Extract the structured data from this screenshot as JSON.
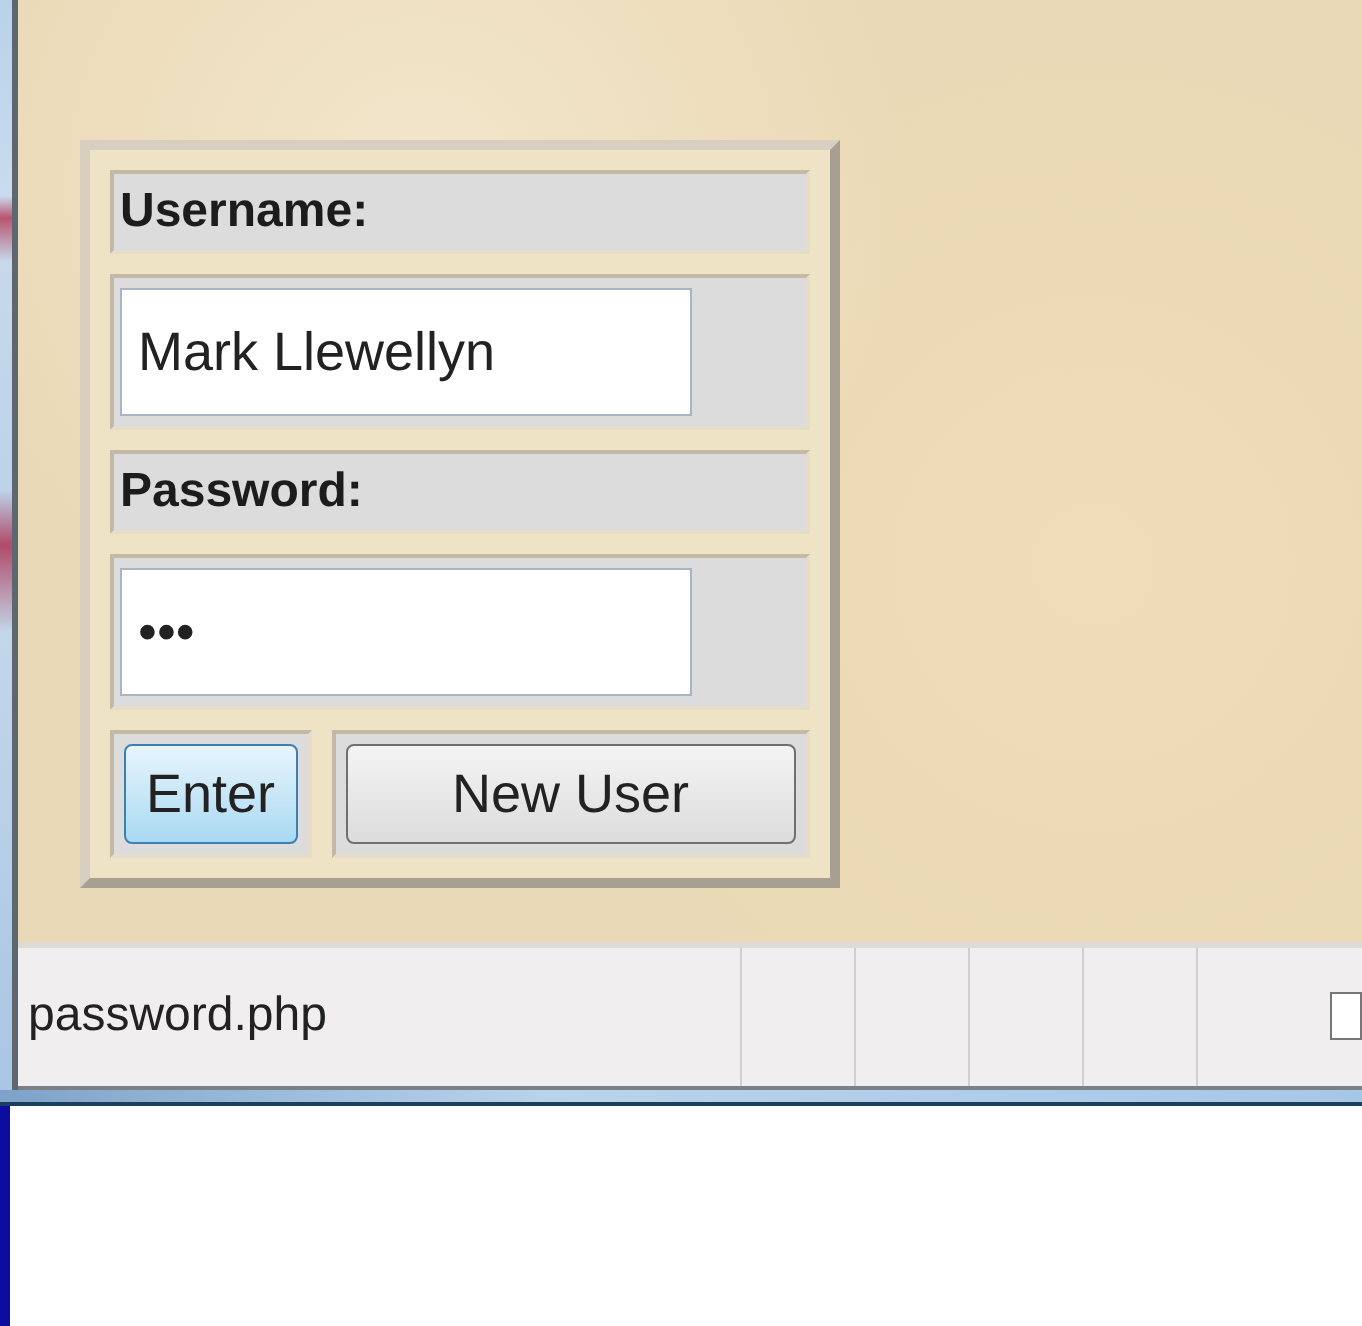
{
  "form": {
    "username_label": "Username:",
    "username": {
      "value": "Mark Llewellyn"
    },
    "password_label": "Password:",
    "password": {
      "value": "•••"
    },
    "buttons": [
      {
        "label": "Enter",
        "default": true
      },
      {
        "label": "New User",
        "default": false
      }
    ]
  },
  "status_bar": {
    "text": "password.php"
  }
}
